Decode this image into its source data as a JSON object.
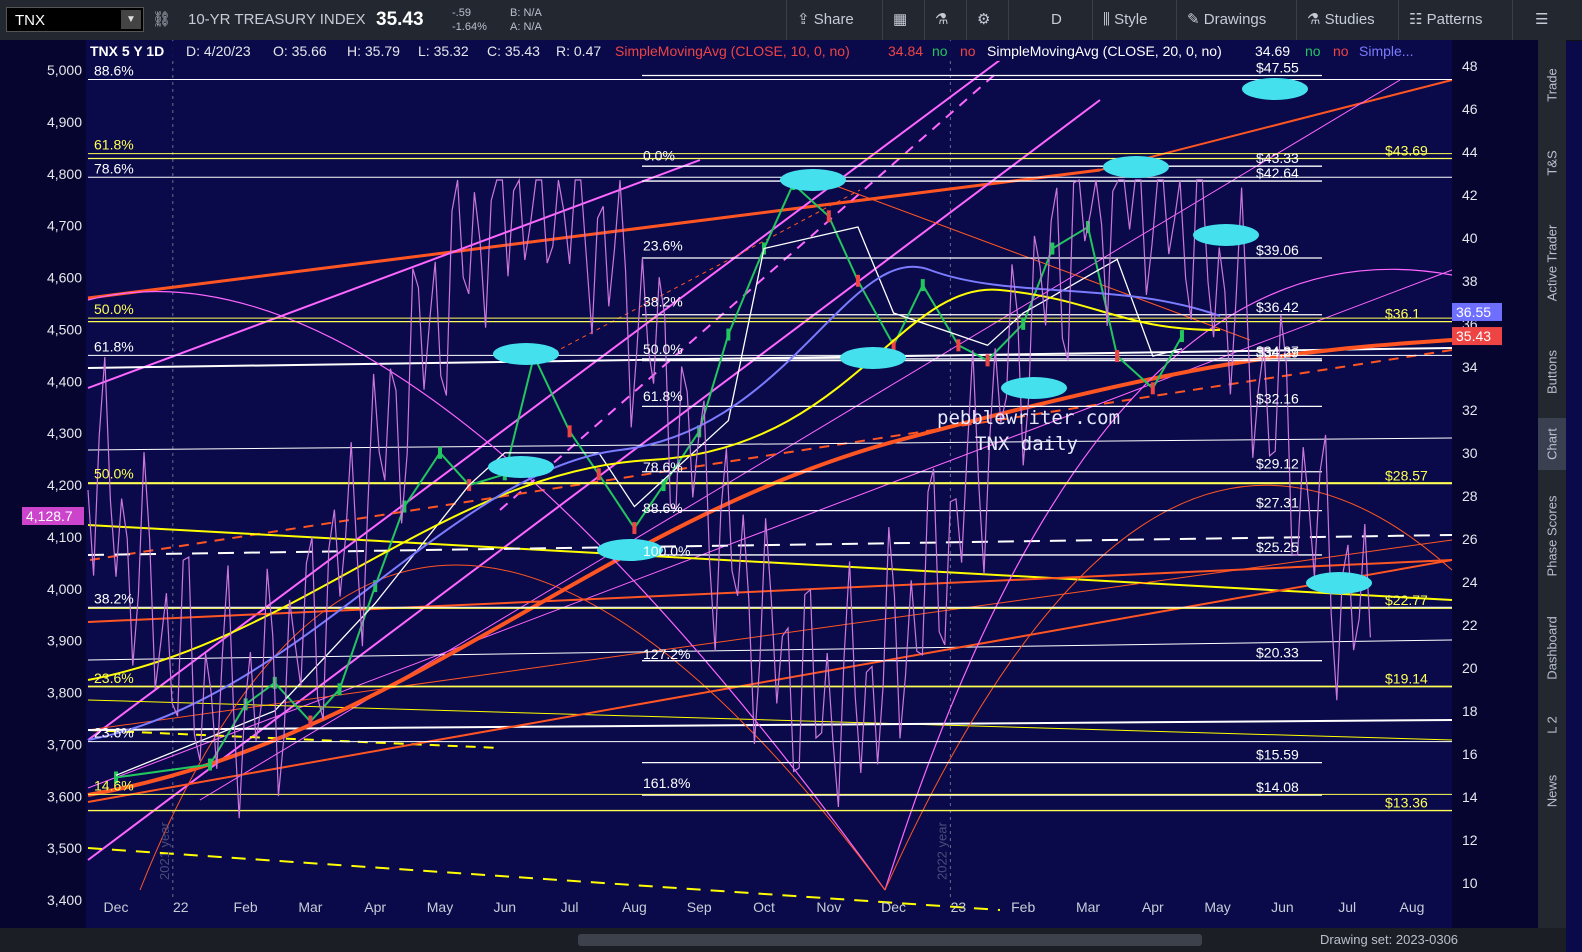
{
  "toolbar": {
    "symbol": "TNX",
    "index_name": "10-YR TREASURY INDEX",
    "last": "35.43",
    "change": "-.59",
    "change_pct": "-1.64%",
    "bid": "B: N/A",
    "ask": "A: N/A",
    "share": "Share",
    "period": "D",
    "style": "Style",
    "drawings": "Drawings",
    "studies": "Studies",
    "patterns": "Patterns"
  },
  "header": {
    "ticker": "TNX 5 Y 1D",
    "date": "D: 4/20/23",
    "open": "O: 35.66",
    "high": "H: 35.79",
    "low": "L: 35.32",
    "close": "C: 35.43",
    "range": "R: 0.47",
    "sma10": "SimpleMovingAvg (CLOSE, 10, 0, no)",
    "sma10_val": "34.84",
    "sma20": "SimpleMovingAvg (CLOSE, 20, 0, no)",
    "sma20_val": "34.69",
    "no": "no",
    "more": "Simple..."
  },
  "sidebar": {
    "items": [
      "Trade",
      "T&S",
      "Active Trader",
      "Buttons",
      "Chart",
      "Phase Scores",
      "Dashboard",
      "L 2",
      "News"
    ]
  },
  "scrollbar": {
    "drawing_set": "Drawing set: 2023-0306"
  },
  "watermark": {
    "line1": "pebblewriter.com",
    "line2": "TNX daily"
  },
  "colors": {
    "background": "#0a0a4a",
    "price_up": "#22c55e",
    "price_down": "#ef4444",
    "fib_white": "#ffffff",
    "fib_yellow": "#ffff55",
    "channel_pink": "#ff66ff",
    "trend_orange": "#ff5522",
    "sma_blue": "#7b7bff",
    "sma_yellow": "#ffff00",
    "cycle_violet": "#cc77dd",
    "marker_cyan": "#44e0ee"
  },
  "chart_data": {
    "type": "line",
    "title": "TNX 5 Y 1D",
    "x_ticks": [
      "Dec",
      "22",
      "Feb",
      "Mar",
      "Apr",
      "May",
      "Jun",
      "Jul",
      "Aug",
      "Sep",
      "Oct",
      "Nov",
      "Dec",
      "23",
      "Feb",
      "Mar",
      "Apr",
      "May",
      "Jun",
      "Jul",
      "Aug"
    ],
    "year_markers": [
      "2021 year",
      "2022 year"
    ],
    "y_right_ticks": [
      48,
      46,
      44,
      42,
      40,
      38,
      36,
      34,
      32,
      30,
      28,
      26,
      24,
      22,
      20,
      18,
      16,
      14,
      12,
      10
    ],
    "y_left_ticks": [
      "5,000",
      "4,900",
      "4,800",
      "4,700",
      "4,600",
      "4,500",
      "4,400",
      "4,300",
      "4,200",
      "4,100",
      "4,000",
      "3,900",
      "3,800",
      "3,700",
      "3,600",
      "3,500",
      "3,400"
    ],
    "ylim_right": [
      9.2,
      49.2
    ],
    "ylim_left": [
      3400,
      5000
    ],
    "left_price_tag": "4,128.7",
    "price_tags": [
      {
        "label": "36.55",
        "value": 36.55,
        "color": "#6f6fff"
      },
      {
        "label": "35.43",
        "value": 35.43,
        "color": "#ef4444"
      }
    ],
    "fib_labels_left": [
      {
        "label": "88.6%",
        "value": 47.55,
        "color": "#ffffff"
      },
      {
        "label": "61.8%",
        "value": 44.1,
        "color": "#ffff55"
      },
      {
        "label": "78.6%",
        "value": 43.0,
        "color": "#ffffff"
      },
      {
        "label": "50.0%",
        "value": 36.45,
        "color": "#ffff55"
      },
      {
        "label": "61.8%",
        "value": 34.72,
        "color": "#ffffff"
      },
      {
        "label": "50.0%",
        "value": 28.8,
        "color": "#ffff55"
      },
      {
        "label": "38.2%",
        "value": 23.0,
        "color": "#ffffff"
      },
      {
        "label": "23.6%",
        "value": 19.3,
        "color": "#ffff55"
      },
      {
        "label": "23.6%",
        "value": 16.75,
        "color": "#ffffff"
      },
      {
        "label": "14.6%",
        "value": 14.3,
        "color": "#ffff55"
      }
    ],
    "fib_labels_mid": [
      {
        "label": "0.0%",
        "value": 43.6
      },
      {
        "label": "23.6%",
        "value": 39.4
      },
      {
        "label": "38.2%",
        "value": 36.8
      },
      {
        "label": "50.0%",
        "value": 34.6
      },
      {
        "label": "61.8%",
        "value": 32.4
      },
      {
        "label": "78.6%",
        "value": 29.1
      },
      {
        "label": "88.6%",
        "value": 27.2
      },
      {
        "label": "100.0%",
        "value": 25.2
      },
      {
        "label": "127.2%",
        "value": 20.4
      },
      {
        "label": "161.8%",
        "value": 14.4
      }
    ],
    "price_levels_right": [
      {
        "label": "$47.55",
        "value": 47.55,
        "color": "#ffffff"
      },
      {
        "label": "$43.33",
        "value": 43.33,
        "color": "#ffffff"
      },
      {
        "label": "$43.69",
        "value": 43.69,
        "color": "#ffff55"
      },
      {
        "label": "$42.64",
        "value": 42.64,
        "color": "#ffffff"
      },
      {
        "label": "$39.06",
        "value": 39.06,
        "color": "#ffffff"
      },
      {
        "label": "$36.42",
        "value": 36.42,
        "color": "#ffffff"
      },
      {
        "label": "$36.1",
        "value": 36.1,
        "color": "#ffff55"
      },
      {
        "label": "$34.29",
        "value": 34.29,
        "color": "#ffffff"
      },
      {
        "label": "$34.37",
        "value": 34.37,
        "color": "#ffffff"
      },
      {
        "label": "$32.16",
        "value": 32.16,
        "color": "#ffffff"
      },
      {
        "label": "$29.12",
        "value": 29.12,
        "color": "#ffffff"
      },
      {
        "label": "$28.57",
        "value": 28.57,
        "color": "#ffff55"
      },
      {
        "label": "$27.31",
        "value": 27.31,
        "color": "#ffffff"
      },
      {
        "label": "$25.25",
        "value": 25.25,
        "color": "#ffffff"
      },
      {
        "label": "$22.77",
        "value": 22.77,
        "color": "#ffff55"
      },
      {
        "label": "$20.33",
        "value": 20.33,
        "color": "#ffffff"
      },
      {
        "label": "$19.14",
        "value": 19.14,
        "color": "#ffff55"
      },
      {
        "label": "$15.59",
        "value": 15.59,
        "color": "#ffffff"
      },
      {
        "label": "$14.08",
        "value": 14.08,
        "color": "#ffffff"
      },
      {
        "label": "$13.36",
        "value": 13.36,
        "color": "#ffff55"
      }
    ],
    "series": [
      {
        "name": "TNX",
        "color": "#22c55e",
        "points": [
          [
            "Dec",
            14.9
          ],
          [
            "22",
            15.5
          ],
          [
            "Feb",
            18.3
          ],
          [
            "Feb",
            19.3
          ],
          [
            "Mar",
            17.5
          ],
          [
            "Mar",
            19.0
          ],
          [
            "Apr",
            23.8
          ],
          [
            "Apr",
            27.5
          ],
          [
            "May",
            30.0
          ],
          [
            "May",
            28.5
          ],
          [
            "Jun",
            29.0
          ],
          [
            "Jun",
            34.5
          ],
          [
            "Jul",
            31.0
          ],
          [
            "Jul",
            29.0
          ],
          [
            "Aug",
            26.5
          ],
          [
            "Aug",
            28.5
          ],
          [
            "Sep",
            31.0
          ],
          [
            "Sep",
            35.5
          ],
          [
            "Oct",
            39.5
          ],
          [
            "Oct",
            42.5
          ],
          [
            "Nov",
            41.0
          ],
          [
            "Nov",
            38.0
          ],
          [
            "Dec",
            35.0
          ],
          [
            "Dec",
            37.8
          ],
          [
            "23",
            35.0
          ],
          [
            "23",
            34.3
          ],
          [
            "Feb",
            36.0
          ],
          [
            "Feb",
            39.5
          ],
          [
            "Mar",
            40.5
          ],
          [
            "Mar",
            34.5
          ],
          [
            "Apr",
            33.0
          ],
          [
            "Apr",
            35.43
          ]
        ]
      },
      {
        "name": "SimpleMovingAvg (CLOSE, 10, 0, no)",
        "color": "#ffffff",
        "points": [
          [
            "Dec",
            15.0
          ],
          [
            "Feb",
            18.0
          ],
          [
            "Apr",
            23.0
          ],
          [
            "May",
            28.5
          ],
          [
            "Jun",
            30.0
          ],
          [
            "Jul",
            30.0
          ],
          [
            "Aug",
            27.5
          ],
          [
            "Sep",
            31.5
          ],
          [
            "Oct",
            39.5
          ],
          [
            "Nov",
            40.5
          ],
          [
            "Dec",
            36.5
          ],
          [
            "23",
            35.0
          ],
          [
            "Feb",
            36.5
          ],
          [
            "Mar",
            39.0
          ],
          [
            "Apr",
            34.5
          ],
          [
            "Apr",
            34.84
          ]
        ]
      }
    ]
  }
}
